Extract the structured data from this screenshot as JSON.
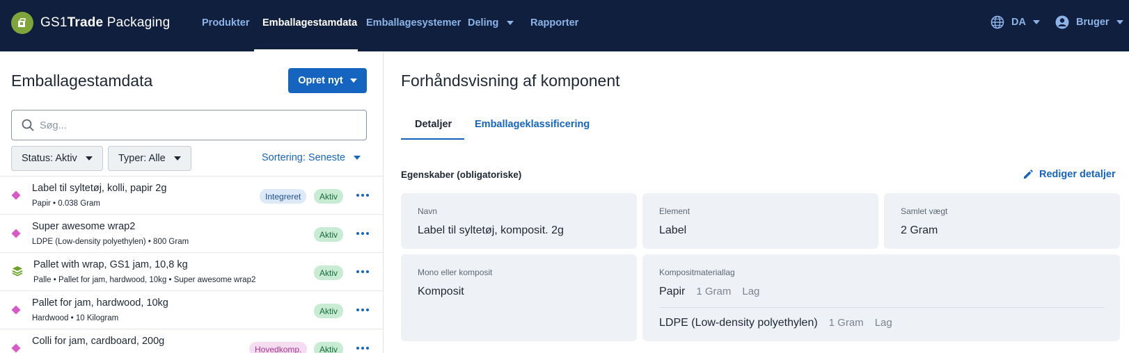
{
  "navbar": {
    "logo_prefix": "GS1",
    "logo_bold": "Trade",
    "logo_suffix": " Packaging",
    "items": [
      {
        "label": "Produkter"
      },
      {
        "label": "Emballagestamdata"
      },
      {
        "label": "Emballagesystemer"
      },
      {
        "label": "Deling"
      },
      {
        "label": "Rapporter"
      }
    ],
    "language": "DA",
    "user": "Bruger"
  },
  "left": {
    "title": "Emballagestamdata",
    "create_button": "Opret nyt",
    "search_placeholder": "Søg...",
    "status_filter": "Status: Aktiv",
    "type_filter": "Typer: Alle",
    "sort": "Sortering: Seneste",
    "items": [
      {
        "title": "Label til syltetøj, kolli, papir 2g",
        "subtitle": "Papir • 0.038 Gram",
        "tag": "Integreret",
        "status": "Aktiv",
        "icon": "diamond-icon"
      },
      {
        "title": "Super awesome wrap2",
        "subtitle": "LDPE (Low-density polyethylen) • 800 Gram",
        "status": "Aktiv",
        "icon": "diamond-icon"
      },
      {
        "title": "Pallet with wrap, GS1 jam, 10,8 kg",
        "subtitle": "Palle • Pallet for jam, hardwood, 10kg • Super awesome wrap2",
        "status": "Aktiv",
        "icon": "layers-icon"
      },
      {
        "title": "Pallet for jam, hardwood, 10kg",
        "subtitle": "Hardwood • 10 Kilogram",
        "status": "Aktiv",
        "icon": "diamond-icon"
      },
      {
        "title": "Colli for jam, cardboard, 200g",
        "subtitle": "",
        "tag": "Hovedkomp.",
        "status": "Aktiv",
        "icon": "diamond-icon"
      }
    ]
  },
  "preview": {
    "title": "Forhåndsvisning af komponent",
    "tabs": [
      {
        "label": "Detaljer"
      },
      {
        "label": "Emballageklassificering"
      }
    ],
    "section_title": "Egenskaber (obligatoriske)",
    "edit_label": "Rediger detaljer",
    "name_label": "Navn",
    "name_value": "Label til syltetøj, komposit. 2g",
    "element_label": "Element",
    "element_value": "Label",
    "weight_label": "Samlet vægt",
    "weight_value": "2 Gram",
    "mono_label": "Mono eller komposit",
    "mono_value": "Komposit",
    "layers_label": "Kompositmateriallag",
    "layers": [
      {
        "material": "Papir",
        "amount": "1 Gram",
        "type": "Lag"
      },
      {
        "material": "LDPE (Low-density polyethylen)",
        "amount": "1 Gram",
        "type": "Lag"
      }
    ]
  },
  "colors": {
    "navbar_bg": "#0f1f3d",
    "accent": "#1565c0",
    "status_green_bg": "#c8ecd3",
    "diamond_magenta": "#d65ac7",
    "layers_green": "#6aa324"
  }
}
